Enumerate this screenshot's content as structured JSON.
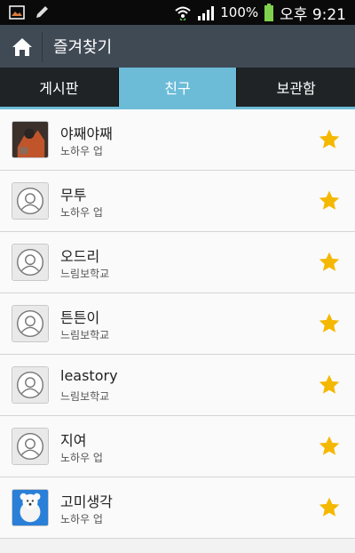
{
  "status": {
    "battery_percent": "100%",
    "time": "오후 9:21",
    "icons": [
      "picture-icon",
      "pencil-icon",
      "wifi-icon",
      "signal-icon",
      "battery-icon"
    ]
  },
  "appbar": {
    "title": "즐겨찾기",
    "home_icon": "home-icon"
  },
  "tabs": [
    {
      "label": "게시판",
      "active": false
    },
    {
      "label": "친구",
      "active": true
    },
    {
      "label": "보관함",
      "active": false
    }
  ],
  "friends": [
    {
      "name": "야째야째",
      "subtitle": "노하우 업",
      "avatar": "photo-avatar"
    },
    {
      "name": "무투",
      "subtitle": "노하우 업",
      "avatar": "default-avatar"
    },
    {
      "name": "오드리",
      "subtitle": "느림보학교",
      "avatar": "default-avatar"
    },
    {
      "name": "튼튼이",
      "subtitle": "느림보학교",
      "avatar": "default-avatar"
    },
    {
      "name": "leastory",
      "subtitle": "느림보학교",
      "avatar": "default-avatar"
    },
    {
      "name": "지여",
      "subtitle": "노하우 업",
      "avatar": "default-avatar"
    },
    {
      "name": "고미생각",
      "subtitle": "노하우 업",
      "avatar": "bear-avatar"
    }
  ],
  "colors": {
    "accent": "#6cbcd8",
    "star": "#f5b800",
    "appbar": "#404a55"
  }
}
